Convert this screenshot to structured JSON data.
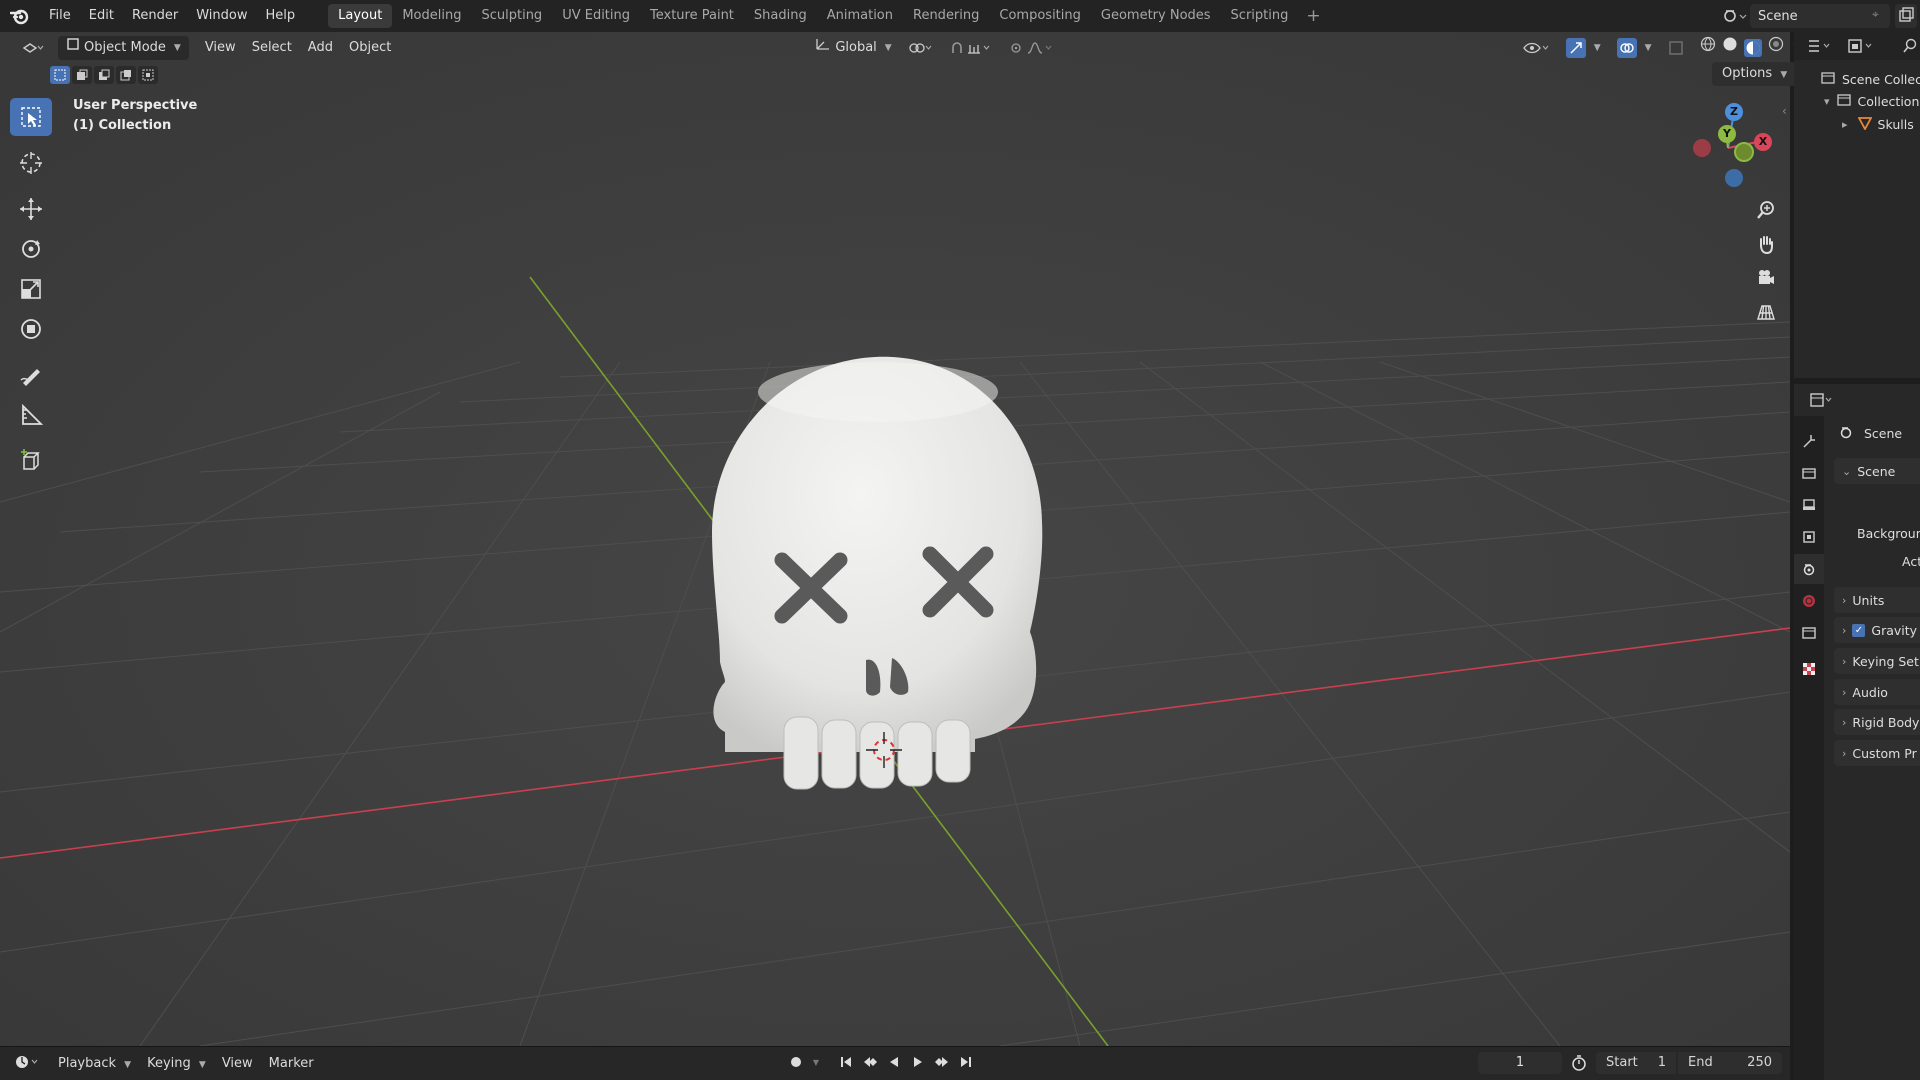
{
  "top_menu": {
    "items": [
      "File",
      "Edit",
      "Render",
      "Window",
      "Help"
    ]
  },
  "workspaces": {
    "tabs": [
      "Layout",
      "Modeling",
      "Sculpting",
      "UV Editing",
      "Texture Paint",
      "Shading",
      "Animation",
      "Rendering",
      "Compositing",
      "Geometry Nodes",
      "Scripting"
    ],
    "active": "Layout",
    "add_icon": "plus-icon"
  },
  "scene_selector": {
    "value": "Scene"
  },
  "viewport_header": {
    "mode": "Object Mode",
    "menus": [
      "View",
      "Select",
      "Add",
      "Object"
    ],
    "transform_orientation": "Global",
    "options_label": "Options"
  },
  "viewport_overlay": {
    "perspective": "User Perspective",
    "collection": "(1) Collection"
  },
  "gizmo": {
    "z": "Z",
    "y": "Y",
    "x": "X"
  },
  "tools": [
    "select-box-icon",
    "cursor-icon",
    "move-icon",
    "rotate-icon",
    "scale-icon",
    "transform-icon",
    "annotate-icon",
    "measure-icon",
    "add-cube-icon"
  ],
  "timeline": {
    "menus": [
      "Playback",
      "Keying",
      "View",
      "Marker"
    ],
    "current_frame": "1",
    "start_label": "Start",
    "start_value": "1",
    "end_label": "End",
    "end_value": "250"
  },
  "outliner": {
    "rows": [
      {
        "label": "Scene Collect",
        "icon": "scene-collection-icon"
      },
      {
        "label": "Collection",
        "icon": "collection-icon"
      },
      {
        "label": "Skulls",
        "icon": "mesh-object-icon"
      }
    ]
  },
  "properties": {
    "header": "Scene",
    "scene_panel": "Scene",
    "field_labels": [
      "Backgroun",
      "Act"
    ],
    "sections": [
      "Units",
      "Gravity",
      "Keying Set",
      "Audio",
      "Rigid Body",
      "Custom Pr"
    ],
    "gravity_checked": true
  },
  "colors": {
    "accent": "#4772b3",
    "viewport_bg": "#3c3c3c",
    "axis_x": "#c8404f",
    "axis_y": "#7aa02c",
    "skull": "#e8e8e6"
  }
}
